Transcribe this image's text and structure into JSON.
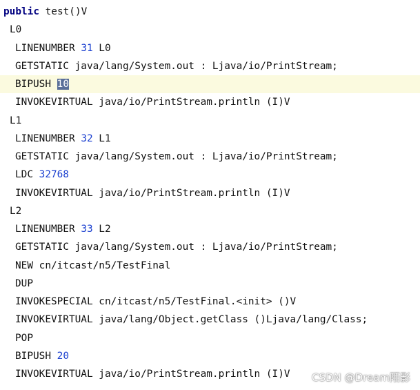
{
  "method": {
    "keyword": "public",
    "signature": " test()V"
  },
  "lines": {
    "l0": "L0",
    "ln31_a": "LINENUMBER ",
    "ln31_n": "31",
    "ln31_b": " L0",
    "gs1": "GETSTATIC java/lang/System.out : Ljava/io/PrintStream;",
    "bipush1_a": "BIPUSH ",
    "bipush1_n": "10",
    "iv1": "INVOKEVIRTUAL java/io/PrintStream.println (I)V",
    "l1": "L1",
    "ln32_a": "LINENUMBER ",
    "ln32_n": "32",
    "ln32_b": " L1",
    "gs2": "GETSTATIC java/lang/System.out : Ljava/io/PrintStream;",
    "ldc_a": "LDC ",
    "ldc_n": "32768",
    "iv2": "INVOKEVIRTUAL java/io/PrintStream.println (I)V",
    "l2": "L2",
    "ln33_a": "LINENUMBER ",
    "ln33_n": "33",
    "ln33_b": " L2",
    "gs3": "GETSTATIC java/lang/System.out : Ljava/io/PrintStream;",
    "new": "NEW cn/itcast/n5/TestFinal",
    "dup": "DUP",
    "invspecial": "INVOKESPECIAL cn/itcast/n5/TestFinal.<init> ()V",
    "iv3": "INVOKEVIRTUAL java/lang/Object.getClass ()Ljava/lang/Class;",
    "pop": "POP",
    "bipush2_a": "BIPUSH ",
    "bipush2_n": "20",
    "iv4": "INVOKEVIRTUAL java/io/PrintStream.println (I)V"
  },
  "watermark": "CSDN @Dream陌影",
  "colors": {
    "keyword": "#000080",
    "number": "#1a3fcf",
    "selection": "#5a6f99",
    "current_line": "#fbfadf"
  }
}
